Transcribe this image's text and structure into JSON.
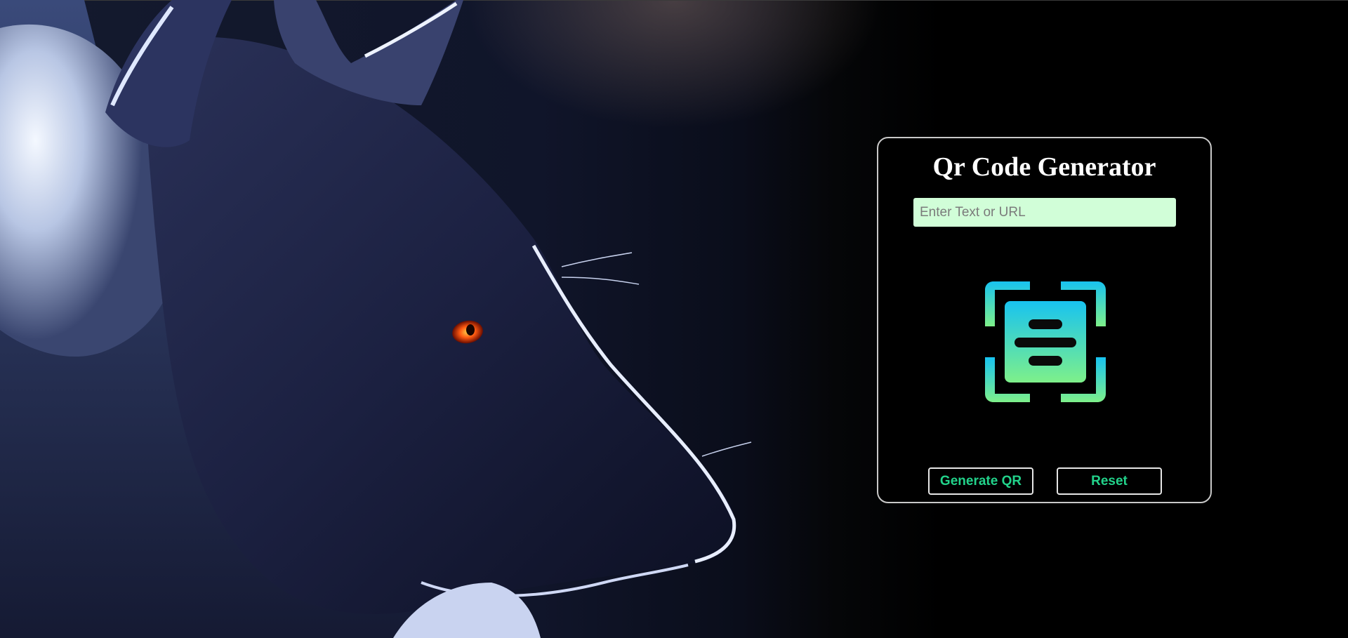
{
  "card": {
    "title": "Qr Code Generator",
    "input": {
      "placeholder": "Enter Text or URL",
      "value": ""
    },
    "qr_icon": "qr-scan-document-icon",
    "buttons": {
      "generate_label": "Generate QR",
      "reset_label": "Reset"
    }
  },
  "background": {
    "image": "wolf-illustration",
    "page_color": "#000000"
  },
  "colors": {
    "accent_green": "#22d38b",
    "input_bg": "#d1fed8",
    "icon_gradient_top": "#18c3f0",
    "icon_gradient_bottom": "#7ef08a",
    "card_border": "#c9c9c9"
  }
}
